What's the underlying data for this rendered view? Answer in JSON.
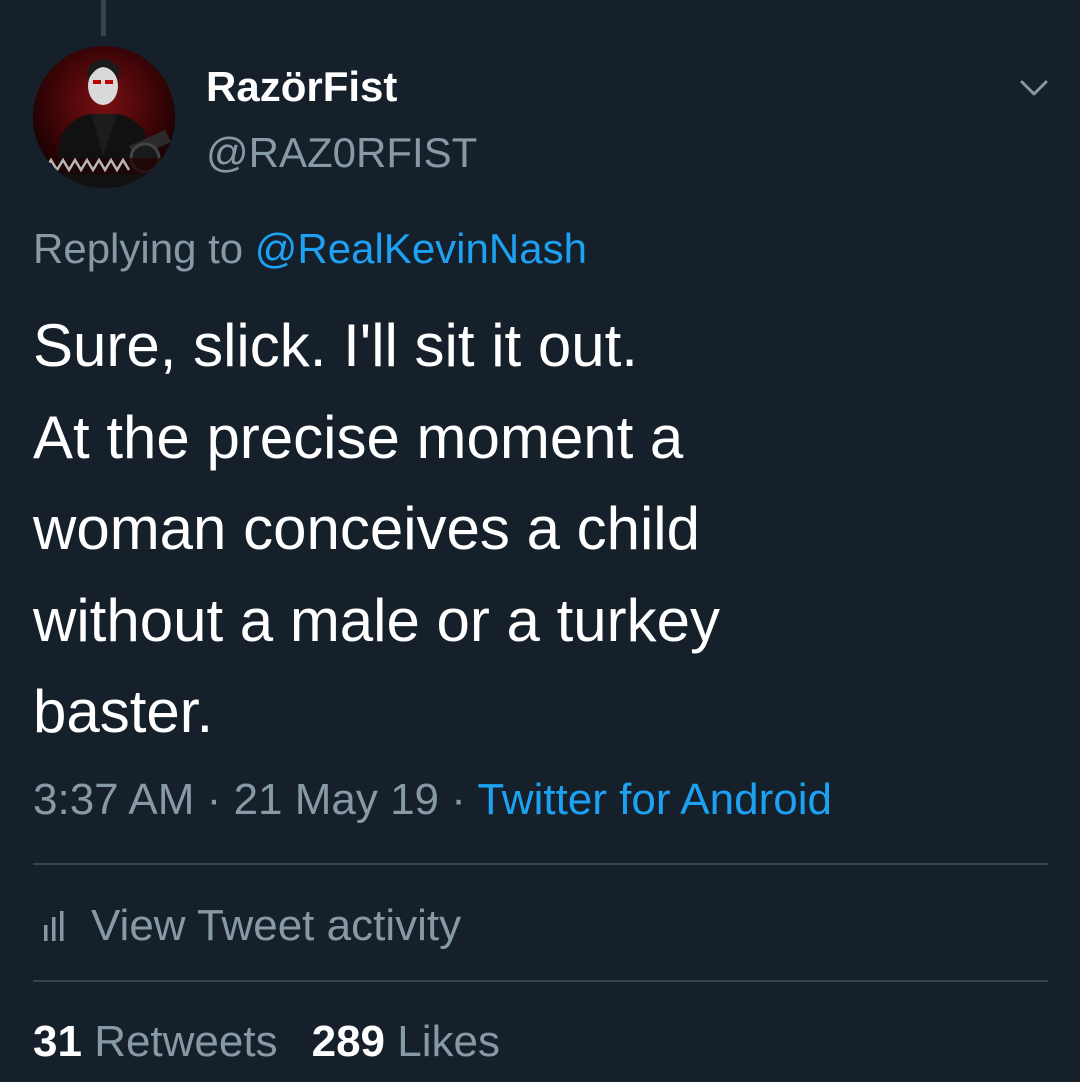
{
  "tweet": {
    "author": {
      "display_name": "RazörFist",
      "handle": "@RAZ0RFIST",
      "avatar_icon": "avatar-image"
    },
    "replying_prefix": "Replying to",
    "replying_to": "@RealKevinNash",
    "text_lines": [
      "Sure, slick. I'll sit it out.",
      "At the precise moment a",
      "woman conceives a child",
      "without a male or a turkey",
      "baster."
    ],
    "time": "3:37 AM",
    "date": "21 May 19",
    "separator": "·",
    "source": "Twitter for Android",
    "activity_label": "View Tweet activity",
    "retweets_count": "31",
    "retweets_label": "Retweets",
    "likes_count": "289",
    "likes_label": "Likes"
  },
  "colors": {
    "background": "#15202b",
    "primary_text": "#ffffff",
    "secondary_text": "#8899a6",
    "accent": "#1da1f2",
    "divider": "#38444d"
  },
  "icons": {
    "menu": "chevron-down-icon",
    "activity": "bar-chart-icon"
  }
}
